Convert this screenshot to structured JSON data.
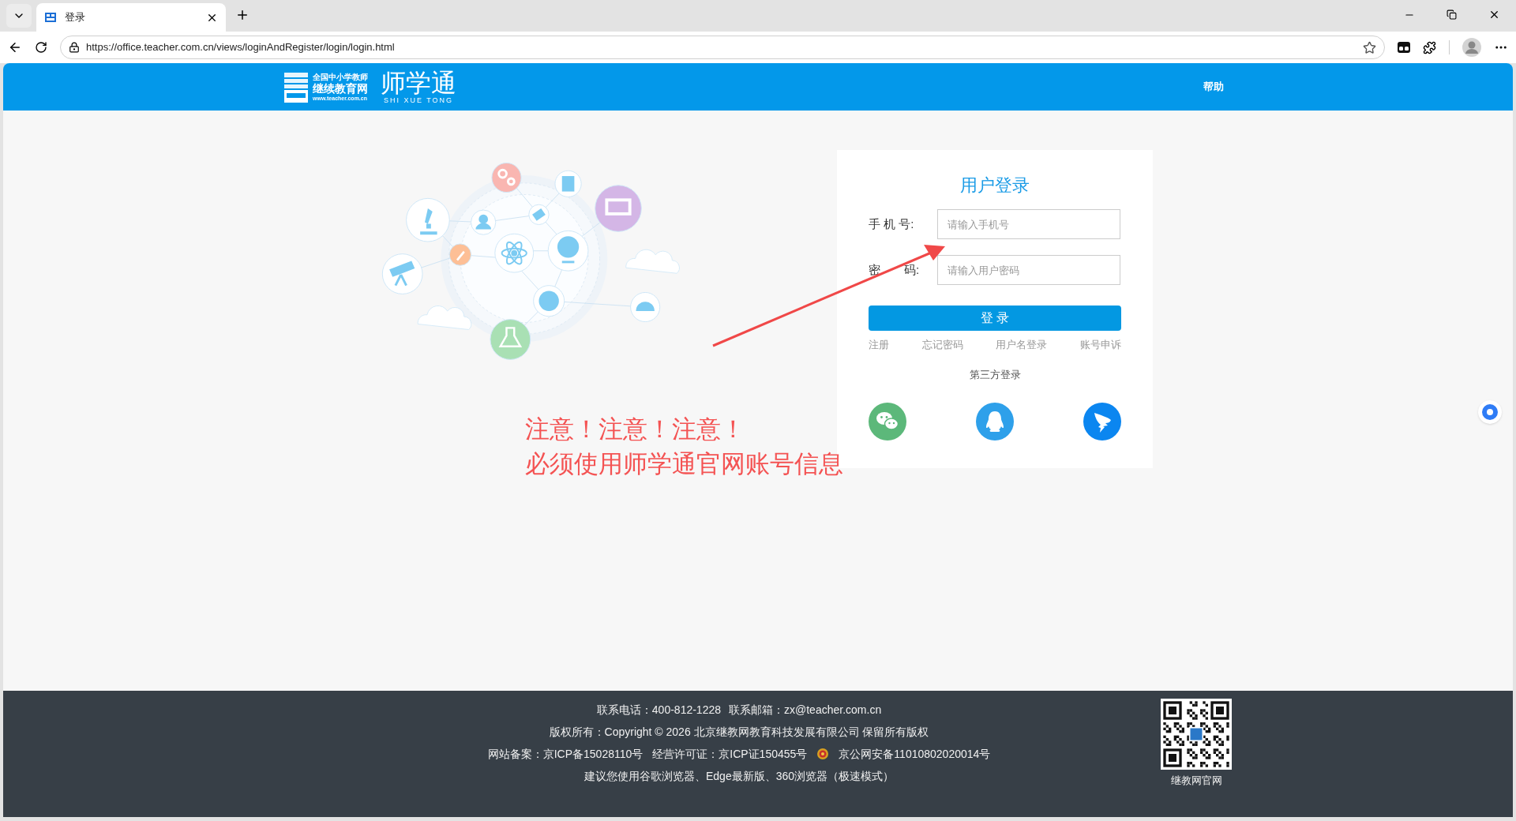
{
  "browser": {
    "tab": {
      "title": "登录",
      "selected": true
    },
    "url": "https://office.teacher.com.cn/views/loginAndRegister/login/login.html"
  },
  "header": {
    "logo_lines": [
      "全国中小学教师",
      "继续教育网",
      "www.teacher.com.cn"
    ],
    "brand": "师学通",
    "brand_sub": "SHI XUE TONG",
    "help": "帮助"
  },
  "login": {
    "title": "用户登录",
    "fields": [
      {
        "label": "手 机 号:",
        "placeholder": "请输入手机号"
      },
      {
        "label": "密　　码:",
        "placeholder": "请输入用户密码"
      }
    ],
    "submit": "登 录",
    "links": [
      "注册",
      "忘记密码",
      "用户名登录",
      "账号申诉"
    ],
    "third_party_title": "第三方登录",
    "third_party": [
      {
        "kind": "wechat"
      },
      {
        "kind": "qq"
      },
      {
        "kind": "dingtalk"
      }
    ]
  },
  "annotation": {
    "lines": [
      "注意！注意！注意！",
      "必须使用师学通官网账号信息"
    ]
  },
  "footer": {
    "contact": [
      "联系电话：400-812-1228",
      "联系邮箱：zx@teacher.com.cn"
    ],
    "copyright": "版权所有：Copyright © 2026 北京继教网教育科技发展有限公司 保留所有版权",
    "records": [
      "网站备案：京ICP备15028110号",
      "经营许可证：京ICP证150455号",
      "京公网安备11010802020014号"
    ],
    "advice": "建议您使用谷歌浏览器、Edge最新版、360浏览器（极速模式）",
    "qr_caption": "继教网官网"
  }
}
